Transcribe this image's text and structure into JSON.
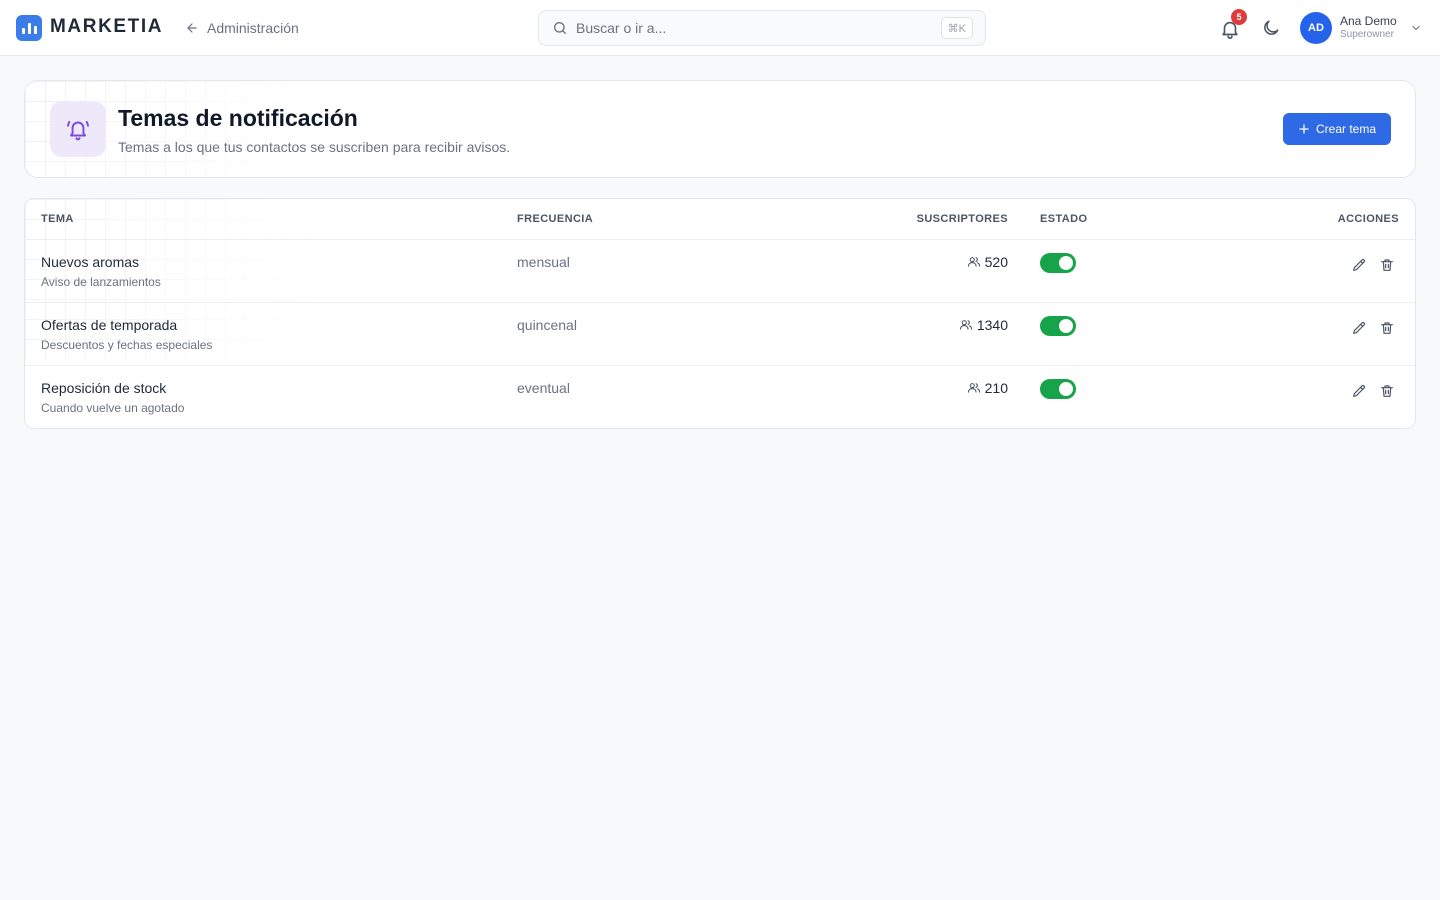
{
  "app": {
    "name": "MARKETIA",
    "accent": "#3b7de8"
  },
  "topbar": {
    "back_label": "Administración",
    "search_placeholder": "Buscar o ir a...",
    "shortcut": "⌘K",
    "notifications_count": "5",
    "user": {
      "initials": "AD",
      "name": "Ana Demo",
      "role": "Superowner"
    }
  },
  "header": {
    "title": "Temas de notificación",
    "subtitle": "Temas a los que tus contactos se suscriben para recibir avisos.",
    "create_label": "Crear tema",
    "icon": "bell-ringing-icon"
  },
  "table": {
    "columns": {
      "tema": "TEMA",
      "frecuencia": "FRECUENCIA",
      "suscriptores": "SUSCRIPTORES",
      "estado": "ESTADO",
      "acciones": "ACCIONES"
    },
    "rows": [
      {
        "title": "Nuevos aromas",
        "desc": "Aviso de lanzamientos",
        "freq": "mensual",
        "subs": "520",
        "active": true
      },
      {
        "title": "Ofertas de temporada",
        "desc": "Descuentos y fechas especiales",
        "freq": "quincenal",
        "subs": "1340",
        "active": true
      },
      {
        "title": "Reposición de stock",
        "desc": "Cuando vuelve un agotado",
        "freq": "eventual",
        "subs": "210",
        "active": true
      }
    ]
  },
  "colors": {
    "primary_button": "#2f6ae6",
    "toggle_on": "#16a34a",
    "badge": "#e03b3b",
    "icon_tile": "#ede9fb",
    "icon_purple": "#7c4ddb"
  }
}
